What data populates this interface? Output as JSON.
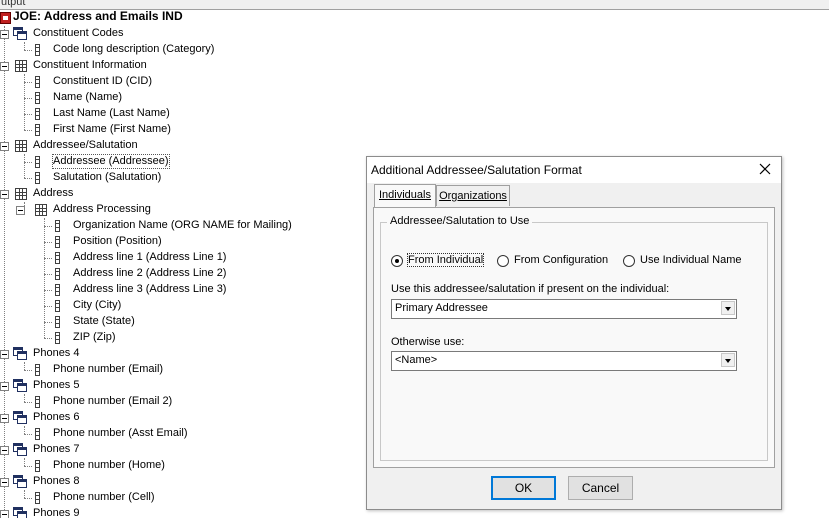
{
  "output_label": "utput",
  "tree": {
    "root": "JOE: Address and Emails IND",
    "nodes": [
      {
        "label": "Constituent Codes"
      },
      {
        "label": "Code long description (Category)"
      },
      {
        "label": "Constituent Information"
      },
      {
        "label": "Constituent ID (CID)"
      },
      {
        "label": "Name (Name)"
      },
      {
        "label": "Last Name (Last Name)"
      },
      {
        "label": "First Name (First Name)"
      },
      {
        "label": "Addressee/Salutation"
      },
      {
        "label": "Addressee (Addressee)"
      },
      {
        "label": "Salutation (Salutation)"
      },
      {
        "label": "Address"
      },
      {
        "label": "Address Processing"
      },
      {
        "label": "Organization Name (ORG NAME for Mailing)"
      },
      {
        "label": "Position (Position)"
      },
      {
        "label": "Address line 1 (Address Line 1)"
      },
      {
        "label": "Address line 2 (Address Line 2)"
      },
      {
        "label": "Address line 3 (Address Line 3)"
      },
      {
        "label": "City (City)"
      },
      {
        "label": "State (State)"
      },
      {
        "label": "ZIP (Zip)"
      },
      {
        "label": "Phones 4"
      },
      {
        "label": "Phone number (Email)"
      },
      {
        "label": "Phones 5"
      },
      {
        "label": "Phone number (Email 2)"
      },
      {
        "label": "Phones 6"
      },
      {
        "label": "Phone number (Asst Email)"
      },
      {
        "label": "Phones 7"
      },
      {
        "label": "Phone number (Home)"
      },
      {
        "label": "Phones 8"
      },
      {
        "label": "Phone number (Cell)"
      },
      {
        "label": "Phones 9"
      }
    ]
  },
  "dialog": {
    "title": "Additional Addressee/Salutation Format",
    "tabs": [
      {
        "label": "Individuals",
        "active": true
      },
      {
        "label": "Organizations",
        "active": false
      }
    ],
    "group_label": "Addressee/Salutation to Use",
    "radios": [
      {
        "label": "From Individual",
        "selected": true
      },
      {
        "label": "From Configuration",
        "selected": false
      },
      {
        "label": "Use Individual Name",
        "selected": false
      }
    ],
    "field1_label": "Use this addressee/salutation if present on the individual:",
    "field1_value": "Primary Addressee",
    "field2_label": "Otherwise use:",
    "field2_value": "<Name>",
    "ok_label": "OK",
    "cancel_label": "Cancel"
  }
}
